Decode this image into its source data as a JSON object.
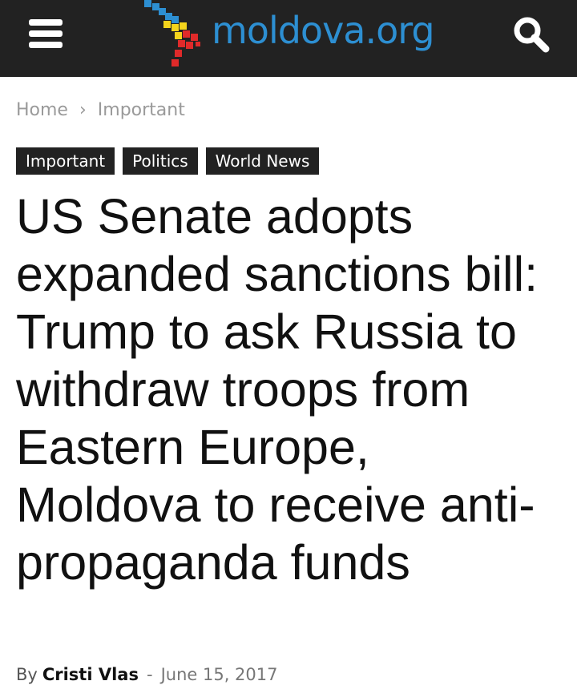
{
  "header": {
    "menu_icon": "hamburger-menu-icon",
    "logo_text": "moldova.org",
    "logo_icon": "moldova-map-icon",
    "search_icon": "search-icon",
    "colors": {
      "bar_background": "#222222",
      "logo_blue": "#2d8fd2",
      "flag_yellow": "#f4d41c",
      "flag_red": "#e02a2a"
    }
  },
  "breadcrumb": {
    "home": "Home",
    "separator": "›",
    "current": "Important"
  },
  "tags": [
    {
      "label": "Important"
    },
    {
      "label": "Politics"
    },
    {
      "label": "World News"
    }
  ],
  "article": {
    "title": "US Senate adopts expanded sanctions bill: Trump to ask Russia to withdraw troops from Eastern Europe, Moldova to receive anti-propaganda funds",
    "byline_prefix": "By",
    "author": "Cristi Vlas",
    "separator": "-",
    "date": "June 15, 2017"
  }
}
